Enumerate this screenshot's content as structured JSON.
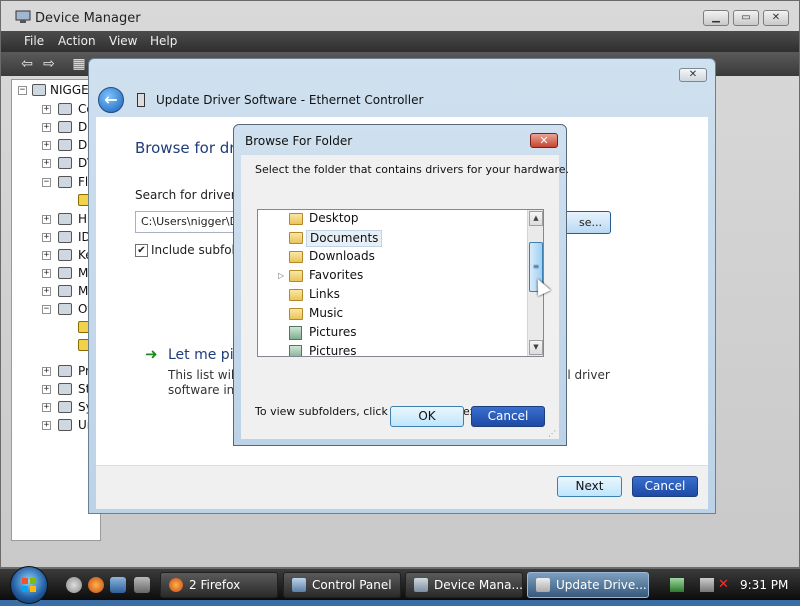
{
  "device_manager": {
    "title": "Device Manager",
    "menu": [
      "File",
      "Action",
      "View",
      "Help"
    ],
    "tree": [
      {
        "label": "NIGGE",
        "exp": "−"
      },
      {
        "label": "Co",
        "exp": "+"
      },
      {
        "label": "Di",
        "exp": "+"
      },
      {
        "label": "Di",
        "exp": "+"
      },
      {
        "label": "DV",
        "exp": "+"
      },
      {
        "label": "Fl",
        "exp": "−"
      },
      {
        "label": "",
        "exp": ""
      },
      {
        "label": "Hu",
        "exp": "+"
      },
      {
        "label": "ID",
        "exp": "+"
      },
      {
        "label": "Ke",
        "exp": "+"
      },
      {
        "label": "M",
        "exp": "+"
      },
      {
        "label": "M",
        "exp": "+"
      },
      {
        "label": "Ot",
        "exp": "−"
      },
      {
        "label": "",
        "exp": ""
      },
      {
        "label": "",
        "exp": ""
      },
      {
        "label": "",
        "exp": ""
      },
      {
        "label": "Pr",
        "exp": "+"
      },
      {
        "label": "St",
        "exp": "+"
      },
      {
        "label": "Sy",
        "exp": "+"
      },
      {
        "label": "Ur",
        "exp": "+"
      }
    ]
  },
  "wizard": {
    "title": "Update Driver Software - Ethernet Controller",
    "heading": "Browse for dri",
    "search_label": "Search for driver so",
    "path_value": "C:\\Users\\nigger\\D",
    "browse_label": "se...",
    "include_subfolders_label": "Include subfold",
    "include_subfolders_checked": true,
    "letme_label": "Let me pi",
    "list_line1": "This list will s",
    "list_line2": "software in t",
    "right_line1": "ll driver",
    "right_line2": "",
    "next_label": "Next",
    "cancel_label": "Cancel"
  },
  "browse_folder": {
    "title": "Browse For Folder",
    "description": "Select the folder that contains drivers for your hardware.",
    "items": [
      {
        "label": "Desktop",
        "icon": "folder-icon",
        "expandable": false,
        "selected": false
      },
      {
        "label": "Documents",
        "icon": "folder-icon",
        "expandable": false,
        "selected": true
      },
      {
        "label": "Downloads",
        "icon": "folder-icon",
        "expandable": false,
        "selected": false
      },
      {
        "label": "Favorites",
        "icon": "folder-icon",
        "expandable": true,
        "selected": false
      },
      {
        "label": "Links",
        "icon": "folder-icon",
        "expandable": false,
        "selected": false
      },
      {
        "label": "Music",
        "icon": "folder-icon",
        "expandable": false,
        "selected": false
      },
      {
        "label": "Pictures",
        "icon": "library-icon",
        "expandable": false,
        "selected": false
      },
      {
        "label": "Pictures",
        "icon": "library-icon",
        "expandable": false,
        "selected": false
      }
    ],
    "hint": "To view subfolders, click the symbol next to a folder.",
    "ok_label": "OK",
    "cancel_label": "Cancel"
  },
  "taskbar": {
    "tasks": [
      {
        "label": "2 Firefox",
        "icon": "firefox-icon",
        "active": false
      },
      {
        "label": "Control Panel",
        "icon": "control-panel-icon",
        "active": false
      },
      {
        "label": "Device Mana...",
        "icon": "device-manager-icon",
        "active": false
      },
      {
        "label": "Update Drive...",
        "icon": "driver-icon",
        "active": true
      }
    ],
    "clock": "9:31 PM"
  },
  "colors": {
    "accent": "#1d4aa5",
    "heading_blue": "#1f3c7a",
    "close_red": "#c84432",
    "green_arrow": "#1e8a1e"
  }
}
